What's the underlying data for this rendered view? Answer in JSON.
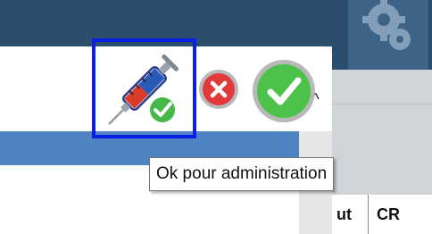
{
  "toolbar": {
    "administer_button_icon": "syringe-check-icon",
    "reject_button_icon": "red-close-icon",
    "accept_button_icon": "green-check-icon"
  },
  "tooltip": {
    "text": "Ok pour administration"
  },
  "grid": {
    "columns": [
      "ut",
      "CR"
    ]
  },
  "scroll": {
    "up_glyph": "^"
  },
  "colors": {
    "highlight_border": "#0a1ee6",
    "header_blue": "#2b4d6e",
    "row_blue": "#4e84c3",
    "reject_red": "#e03a3a",
    "accept_green": "#4cc24a"
  }
}
